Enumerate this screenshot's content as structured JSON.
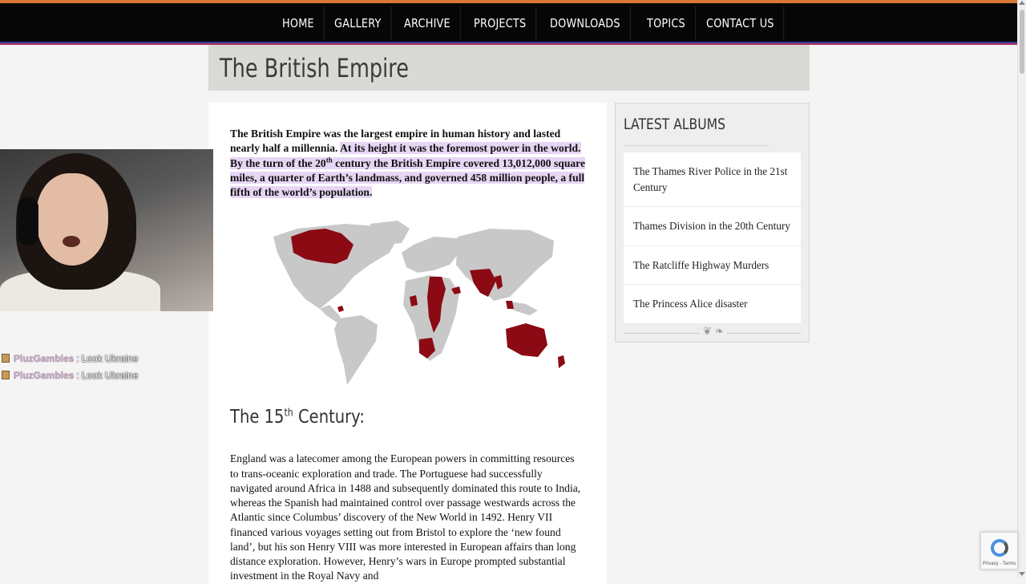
{
  "nav": {
    "items": [
      "HOME",
      "GALLERY",
      "ARCHIVE",
      "PROJECTS",
      "DOWNLOADS",
      "TOPICS",
      "CONTACT US"
    ]
  },
  "page": {
    "title": "The British Empire"
  },
  "article": {
    "intro_plain": "The British Empire was the largest empire in human history and lasted nearly half a millennia. ",
    "intro_hl_1": "At its height it was the foremost power in the world. By the turn of the 20",
    "intro_sup": "th",
    "intro_hl_2": " century the British Empire covered 13,012,000 square miles, a quarter of Earth’s landmass, and governed 458 million people, a full fifth of the world’s population.",
    "section_heading_pre": "The 15",
    "section_heading_sup": "th",
    "section_heading_post": " Century:",
    "section_body": "England was a latecomer among the European powers in committing resources to trans-oceanic exploration and trade. The Portuguese had successfully navigated around Africa in 1488 and subsequently dominated this route to India, whereas the Spanish had maintained control over passage westwards across the Atlantic since Columbus’ discovery of the New World in 1492. Henry VII financed various voyages setting out from Bristol to explore the ‘new found land’, but his son Henry VIII was more interested in European affairs than long distance exploration. However, Henry’s wars in Europe prompted substantial investment in the Royal Navy and"
  },
  "sidebar": {
    "heading": "LATEST ALBUMS",
    "albums": [
      "The Thames River Police in the 21st Century",
      "Thames Division in the 20th Century",
      "The Ratcliffe Highway Murders",
      "The Princess Alice disaster"
    ],
    "divider_glyph": "❦ ❧"
  },
  "chat": {
    "messages": [
      {
        "user": "PluzGambles",
        "sep": ":",
        "text": "Look Ukraine"
      },
      {
        "user": "PluzGambles",
        "sep": ":",
        "text": "Look Ukraine"
      }
    ]
  },
  "recaptcha": {
    "footer": "Privacy - Terms"
  },
  "colors": {
    "empire_red": "#8b0a14",
    "land_gray": "#c8c8c8",
    "highlight": "#e6d6f4",
    "nav_bg": "#060606",
    "nav_accent": "#d8793a"
  }
}
